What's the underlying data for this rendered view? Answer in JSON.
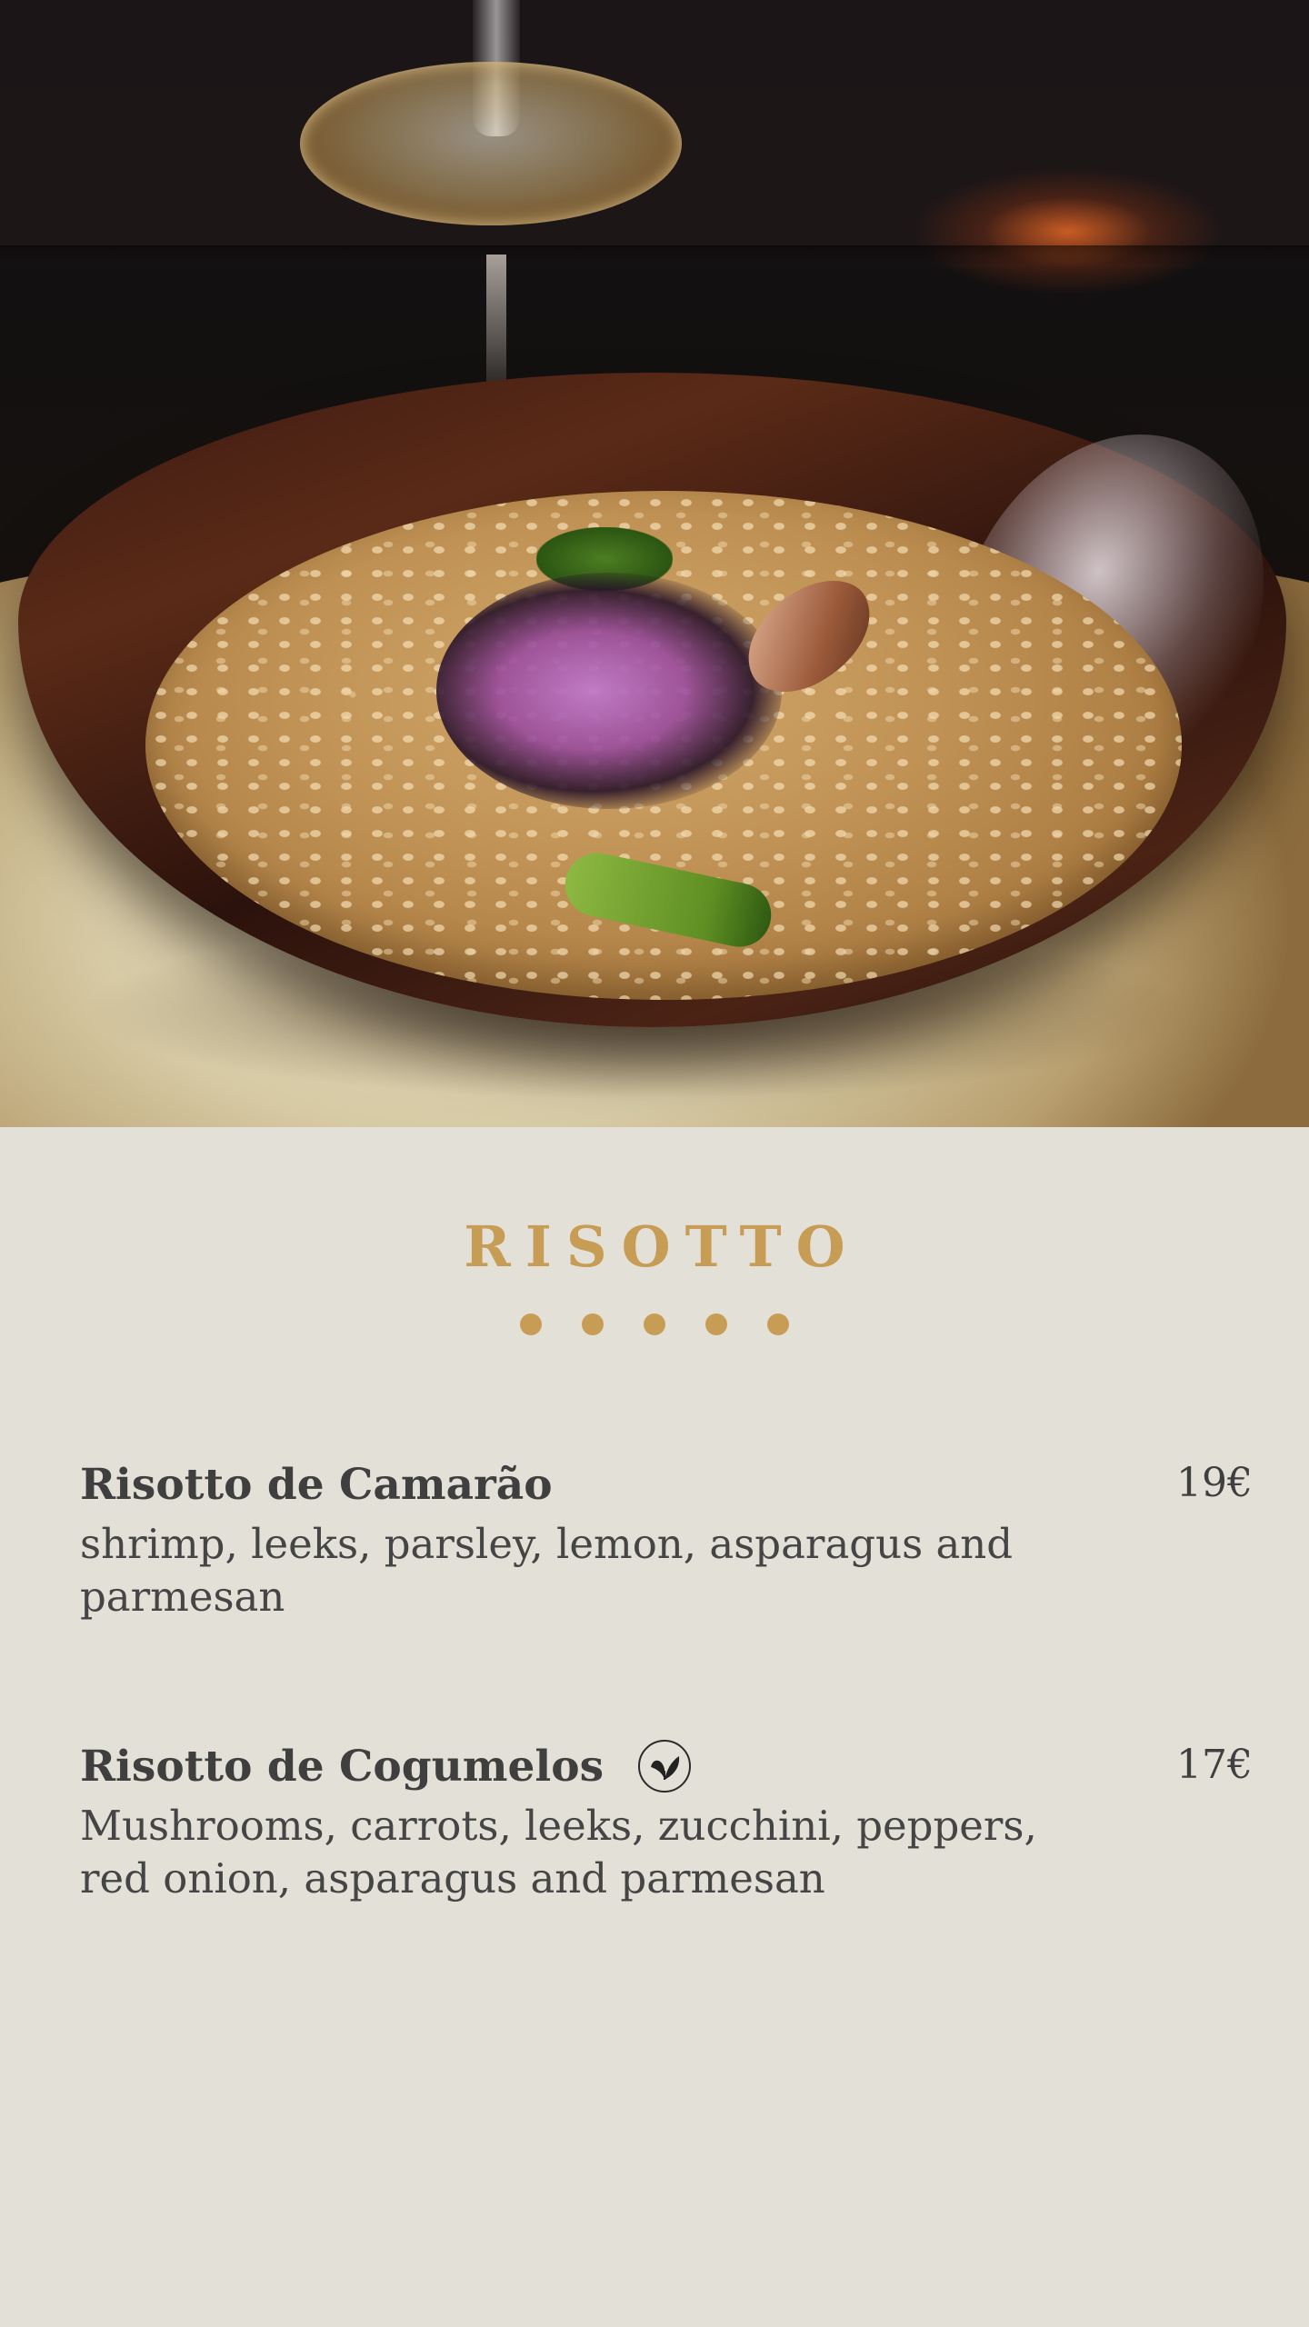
{
  "section": {
    "title": "RISOTTO",
    "accent_color": "#c79d55"
  },
  "hero_image": {
    "description_icon": "risotto-bowl-photo"
  },
  "items": [
    {
      "name": "Risotto de Camarão",
      "description": "shrimp, leeks, parsley, lemon, asparagus and parmesan",
      "price": "19€",
      "vegetarian": false
    },
    {
      "name": "Risotto de Cogumelos",
      "description": "Mushrooms, carrots, leeks, zucchini, peppers, red onion, asparagus and parmesan",
      "price": "17€",
      "vegetarian": true,
      "icon": "vegetarian-leaf-icon"
    }
  ]
}
